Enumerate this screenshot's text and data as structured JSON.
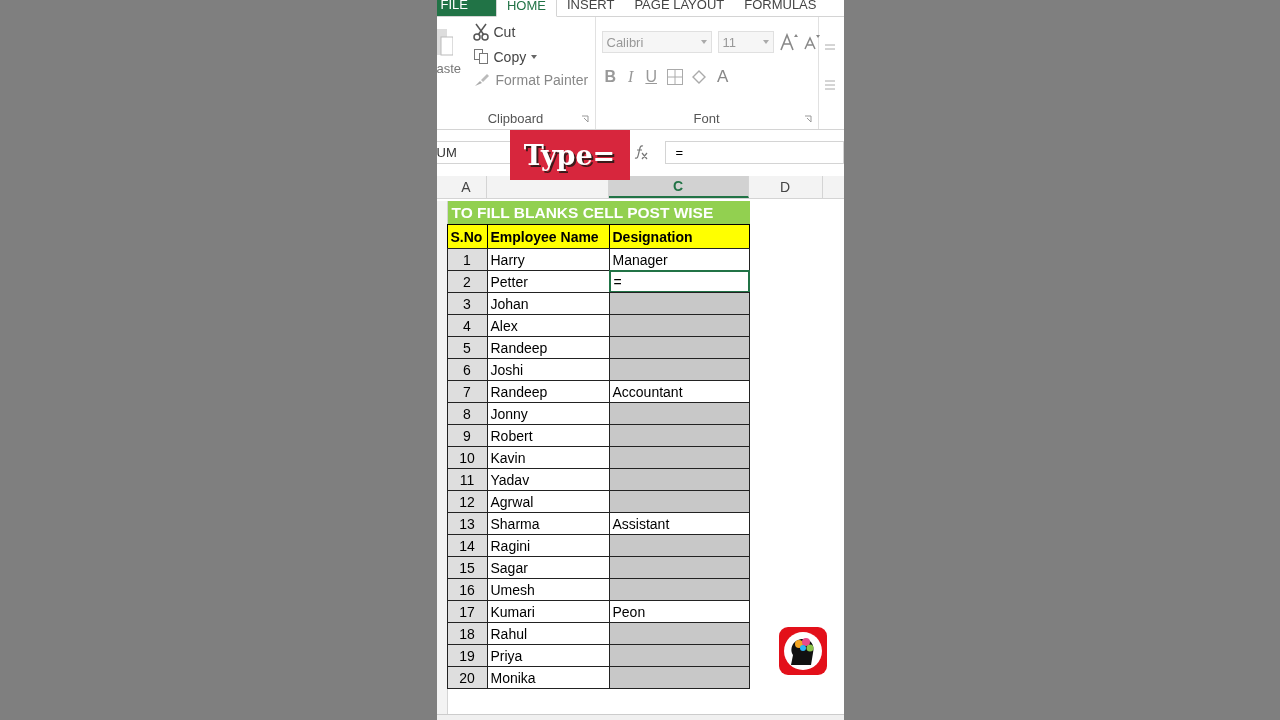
{
  "ribbon_tabs": [
    {
      "label": "FILE",
      "kind": "file",
      "selected": false
    },
    {
      "label": "HOME",
      "kind": "tab",
      "selected": true
    },
    {
      "label": "INSERT",
      "kind": "tab",
      "selected": false
    },
    {
      "label": "PAGE LAYOUT",
      "kind": "tab",
      "selected": false
    },
    {
      "label": "FORMULAS",
      "kind": "tab",
      "selected": false
    }
  ],
  "clipboard": {
    "paste": "aste",
    "cut": "Cut",
    "copy": "Copy",
    "format_painter": "Format Painter",
    "label": "Clipboard"
  },
  "font": {
    "family": "Calibri",
    "size": "11",
    "bold": "B",
    "italic": "I",
    "underline": "U",
    "font_color": "A",
    "label": "Font"
  },
  "formula_bar": {
    "name_box": "UM",
    "value": "="
  },
  "overlay": "Type=",
  "columns": [
    {
      "label": "A",
      "selected": false
    },
    {
      "selected": false
    },
    {
      "label": "C",
      "selected": true
    },
    {
      "label": "D",
      "selected": false
    }
  ],
  "sheet": {
    "title": "TO FILL BLANKS CELL POST WISE",
    "headers": [
      "S.No",
      "Employee Name",
      "Designation"
    ],
    "rows": [
      {
        "no": "1",
        "name": "Harry",
        "designation": "Manager",
        "selected": false,
        "active": false
      },
      {
        "no": "2",
        "name": "Petter",
        "designation": "=",
        "selected": false,
        "active": true
      },
      {
        "no": "3",
        "name": "Johan",
        "selected": true,
        "active": false
      },
      {
        "no": "4",
        "name": "Alex",
        "selected": true,
        "active": false
      },
      {
        "no": "5",
        "name": "Randeep",
        "selected": true,
        "active": false
      },
      {
        "no": "6",
        "name": "Joshi",
        "selected": true,
        "active": false
      },
      {
        "no": "7",
        "name": "Randeep",
        "designation": "Accountant",
        "selected": false,
        "active": false
      },
      {
        "no": "8",
        "name": "Jonny",
        "selected": true,
        "active": false
      },
      {
        "no": "9",
        "name": "Robert",
        "selected": true,
        "active": false
      },
      {
        "no": "10",
        "name": "Kavin",
        "selected": true,
        "active": false
      },
      {
        "no": "11",
        "name": "Yadav",
        "selected": true,
        "active": false
      },
      {
        "no": "12",
        "name": "Agrwal",
        "selected": true,
        "active": false
      },
      {
        "no": "13",
        "name": "Sharma",
        "designation": "Assistant",
        "selected": false,
        "active": false
      },
      {
        "no": "14",
        "name": "Ragini",
        "selected": true,
        "active": false
      },
      {
        "no": "15",
        "name": "Sagar",
        "selected": true,
        "active": false
      },
      {
        "no": "16",
        "name": "Umesh",
        "selected": true,
        "active": false
      },
      {
        "no": "17",
        "name": "Kumari",
        "designation": "Peon",
        "selected": false,
        "active": false
      },
      {
        "no": "18",
        "name": "Rahul",
        "selected": true,
        "active": false
      },
      {
        "no": "19",
        "name": "Priya",
        "selected": true,
        "active": false
      },
      {
        "no": "20",
        "name": "Monika",
        "selected": true,
        "active": false
      }
    ]
  }
}
